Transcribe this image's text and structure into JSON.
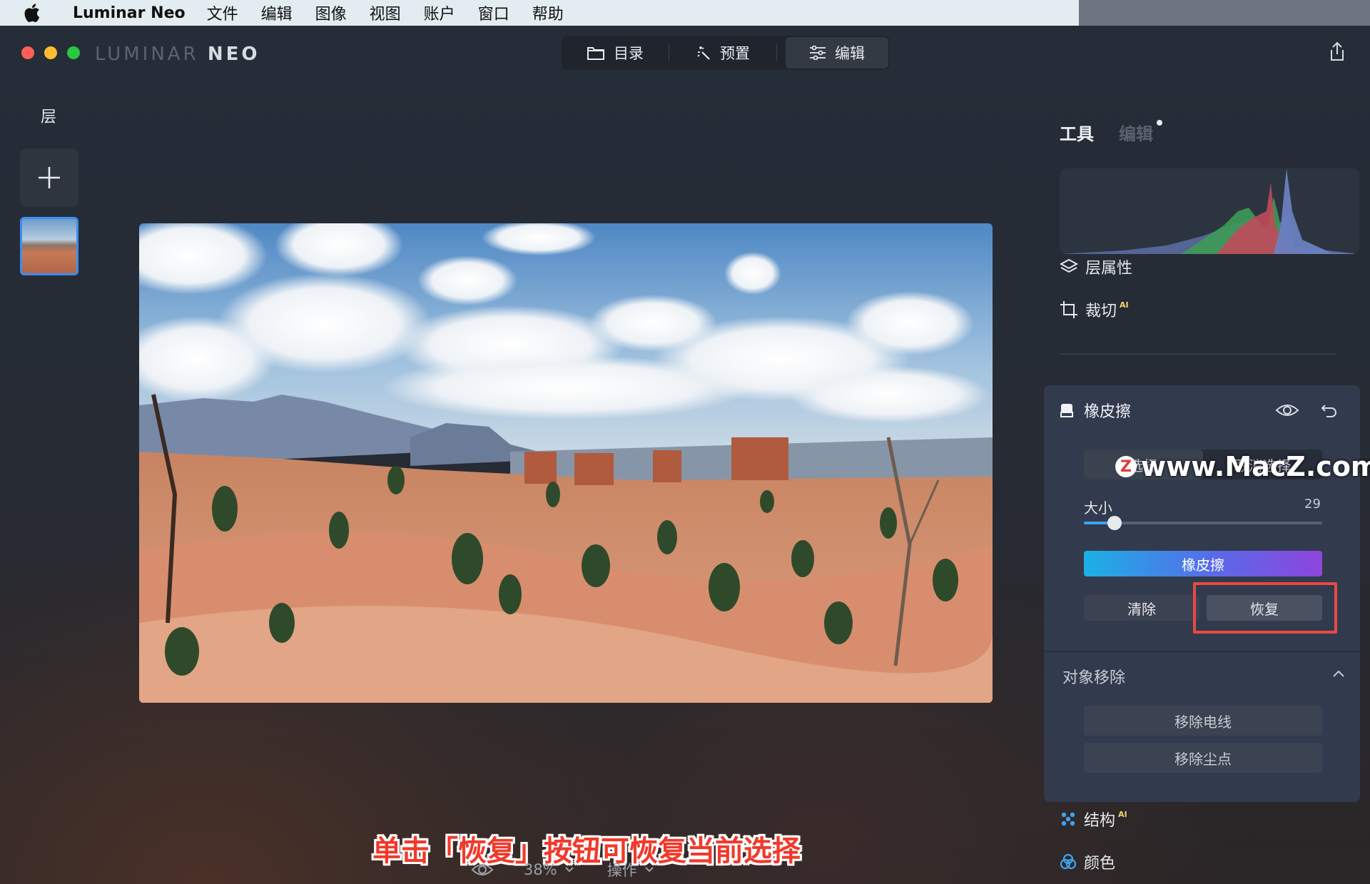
{
  "menubar": {
    "app_name": "Luminar Neo",
    "items": [
      "文件",
      "编辑",
      "图像",
      "视图",
      "账户",
      "窗口",
      "帮助"
    ]
  },
  "window": {
    "logo_left": "LUMINAR",
    "logo_right": "NEO",
    "nav": {
      "catalog": "目录",
      "presets": "预置",
      "edit": "编辑"
    }
  },
  "layers": {
    "title": "层"
  },
  "bottom_bar": {
    "zoom": "38%",
    "actions": "操作"
  },
  "caption": "单击「恢复」按钮可恢复当前选择",
  "right_panel": {
    "tab_tools": "工具",
    "tab_edits": "编辑",
    "layer_properties": "层属性",
    "crop": "裁切",
    "crop_badge": "AI",
    "eraser": {
      "title": "橡皮擦",
      "seg_select": "选择",
      "seg_deselect": "取消选择",
      "size_label": "大小",
      "size_value": "29",
      "size_fraction": 0.13,
      "erase_button": "橡皮擦",
      "clear_button": "清除",
      "restore_button": "恢复"
    },
    "object_removal": {
      "title": "对象移除",
      "remove_powerlines": "移除电线",
      "remove_dust": "移除尘点"
    },
    "structure": "结构",
    "structure_badge": "AI",
    "color": "颜色"
  },
  "watermark": {
    "badge": "Z",
    "text": "www.MacZ.com"
  },
  "colors": {
    "accent_blue": "#3a8ef6",
    "highlight_red": "#e84a43",
    "eraser_gradient_start": "#1cb0e6",
    "eraser_gradient_end": "#8d45dc"
  },
  "icons": [
    "apple-icon",
    "folder-icon",
    "magic-wand-icon",
    "sliders-icon",
    "share-icon",
    "plus-icon",
    "eye-icon",
    "chevron-down-icon",
    "layers-icon",
    "crop-icon",
    "eraser-icon",
    "undo-icon",
    "chevron-up-icon",
    "structure-icon",
    "color-icon"
  ]
}
